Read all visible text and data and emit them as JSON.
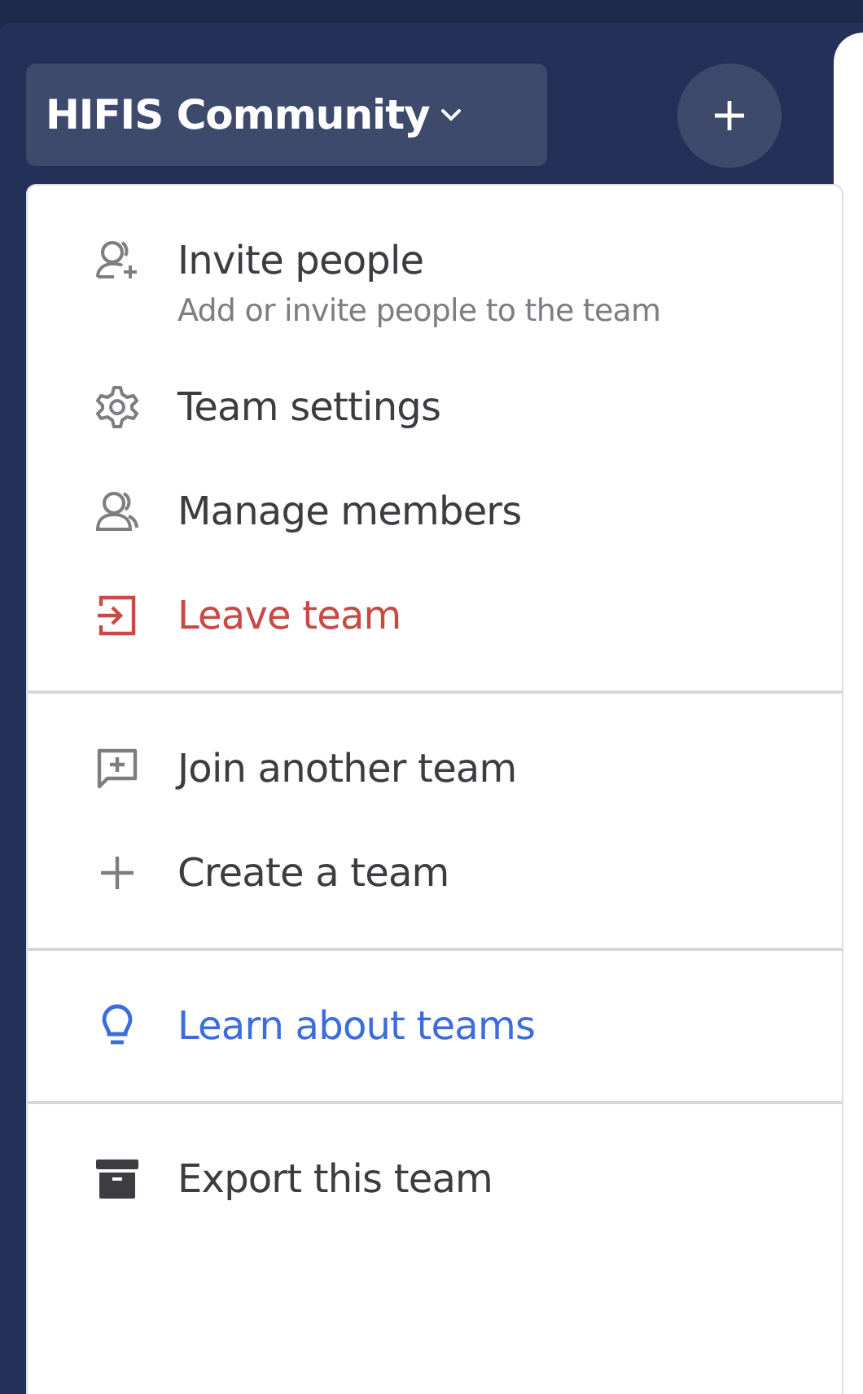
{
  "team_switcher": {
    "label": "HIFIS Community",
    "expanded": true
  },
  "menu": {
    "sections": [
      {
        "items": [
          {
            "kind": "normal",
            "label": "Invite people",
            "description": "Add or invite people to the team"
          },
          {
            "kind": "normal",
            "label": "Team settings"
          },
          {
            "kind": "normal",
            "label": "Manage members"
          },
          {
            "kind": "danger",
            "label": "Leave team"
          }
        ]
      },
      {
        "items": [
          {
            "kind": "normal",
            "label": "Join another team"
          },
          {
            "kind": "normal",
            "label": "Create a team"
          }
        ]
      },
      {
        "items": [
          {
            "kind": "link",
            "label": "Learn about teams"
          }
        ]
      },
      {
        "items": [
          {
            "kind": "normal",
            "label": "Export this team"
          }
        ]
      }
    ]
  }
}
